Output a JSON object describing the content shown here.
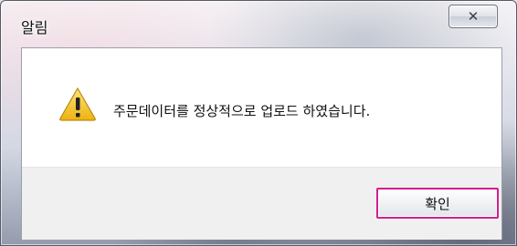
{
  "window": {
    "title": "알림"
  },
  "titlebar": {
    "close_icon": "close-icon"
  },
  "dialog": {
    "icon": "warning-icon",
    "message": "주문데이터를 정상적으로 업로드 하였습니다.",
    "ok_label": "확인"
  },
  "colors": {
    "ok_button_highlight": "#d21f8f",
    "warning_yellow": "#f3c21a",
    "client_background": "#ffffff",
    "footer_background": "#f0f0f0"
  }
}
